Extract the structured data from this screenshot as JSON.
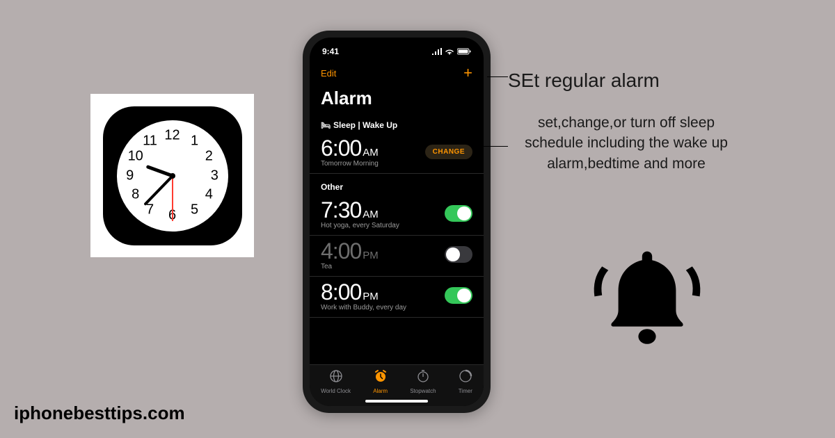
{
  "clock_icon": {
    "numbers": [
      "12",
      "1",
      "2",
      "3",
      "4",
      "5",
      "6",
      "7",
      "8",
      "9",
      "10",
      "11"
    ]
  },
  "phone": {
    "status_time": "9:41",
    "edit": "Edit",
    "plus": "+",
    "title": "Alarm",
    "sleep_header": "Sleep | Wake Up",
    "sleep_alarm": {
      "time": "6:00",
      "ampm": "AM",
      "label": "Tomorrow Morning",
      "change": "CHANGE"
    },
    "other_header": "Other",
    "alarms": [
      {
        "time": "7:30",
        "ampm": "AM",
        "label": "Hot yoga, every Saturday",
        "on": true
      },
      {
        "time": "4:00",
        "ampm": "PM",
        "label": "Tea",
        "on": false
      },
      {
        "time": "8:00",
        "ampm": "PM",
        "label": "Work with Buddy, every day",
        "on": true
      }
    ],
    "tabs": [
      {
        "label": "World Clock",
        "icon": "globe"
      },
      {
        "label": "Alarm",
        "icon": "alarm",
        "active": true
      },
      {
        "label": "Stopwatch",
        "icon": "stopwatch"
      },
      {
        "label": "Timer",
        "icon": "timer"
      }
    ]
  },
  "right": {
    "headline": "SEt  regular alarm",
    "subtext": "set,change,or turn off sleep schedule including the wake up alarm,bedtime and more"
  },
  "footer": "iphonebesttips.com"
}
